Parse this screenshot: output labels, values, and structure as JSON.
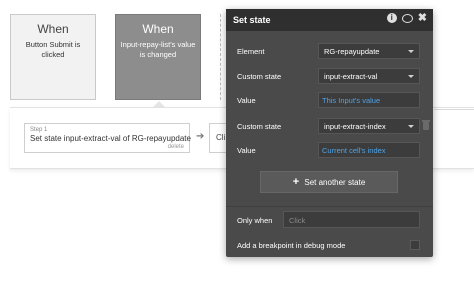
{
  "events": [
    {
      "title": "When",
      "description": "Button Submit is clicked"
    },
    {
      "title": "When",
      "description": "Input-repay-list's value is changed"
    }
  ],
  "step": {
    "number": "Step 1",
    "title": "Set state input-extract-val of RG-repayupdate",
    "delete_label": "delete",
    "next_label": "Cli"
  },
  "panel": {
    "title": "Set state",
    "icons": [
      "info-icon",
      "comment-icon",
      "close-icon"
    ],
    "element_label": "Element",
    "element_value": "RG-repayupdate",
    "states": [
      {
        "state_label": "Custom state",
        "state_value": "input-extract-val",
        "value_label": "Value",
        "value": "This Input's value"
      },
      {
        "state_label": "Custom state",
        "state_value": "input-extract-index",
        "value_label": "Value",
        "value": "Current cell's index"
      }
    ],
    "add_button": "Set another state",
    "only_when_label": "Only when",
    "only_when_placeholder": "Click",
    "breakpoint_label": "Add a breakpoint in debug mode"
  },
  "colors": {
    "panel_bg": "#4a4a4a",
    "panel_header": "#2f2f2f",
    "link_blue": "#4fa3e8",
    "selected_event_bg": "#8d8d8d"
  }
}
